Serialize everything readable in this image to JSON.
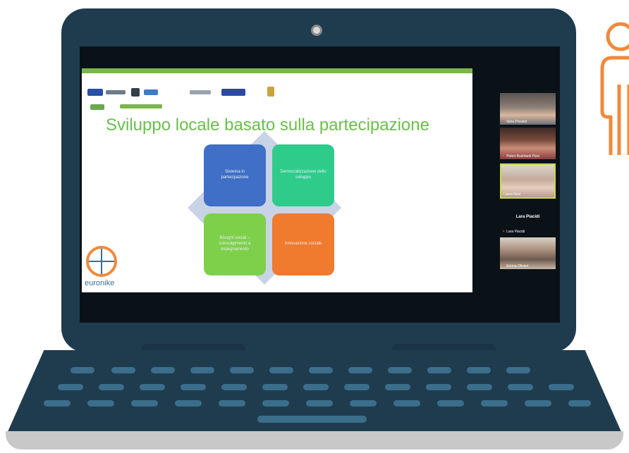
{
  "slide": {
    "title": "Sviluppo locale basato sulla partecipazione",
    "quadrants": [
      {
        "label": "Sistema in partecipazione",
        "color": "#3f6fc6"
      },
      {
        "label": "Democratizzazione dello sviluppo",
        "color": "#2ecb8b"
      },
      {
        "label": "Bisogni sociali – coinvolgimento e impegnamento",
        "color": "#7ed04b"
      },
      {
        "label": "Innovazione sociale",
        "color": "#f07a2e"
      }
    ],
    "brand": "euronike",
    "accent_color": "#7ab648",
    "title_color": "#6abf4b"
  },
  "participants": [
    {
      "name": "Ilaria Prestini"
    },
    {
      "name": "Pietro Bustriaoli Pizzi"
    },
    {
      "name": "Laura Nesi"
    },
    {
      "name": "Lara Piacidi",
      "camera_off": true
    },
    {
      "name": "Emma Olivieri"
    }
  ],
  "colors": {
    "laptop_body": "#1f3c4f",
    "keys": "#3b6e8a",
    "person_icon": "#f08a3c"
  },
  "icons": [
    "webcam-icon",
    "person-icon",
    "globe-icon",
    "muted-mic-icon"
  ]
}
